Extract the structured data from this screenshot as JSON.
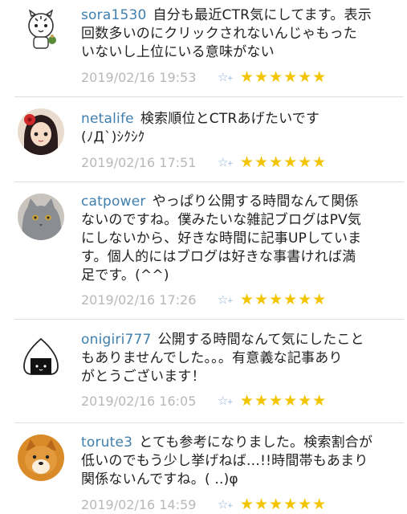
{
  "comments": [
    {
      "user": "sora1530",
      "body_lines": [
        "自分も最近CTR気にしてます。表示",
        "回数多いのにクリックされないんじゃもった",
        "いないし上位にいる意味がない"
      ],
      "timestamp": "2019/02/16 19:53",
      "add_star": "☆",
      "stars": "★★★★★★",
      "avatar": "cartoon-tiger-avatar"
    },
    {
      "user": "netalife",
      "body_lines": [
        "検索順位とCTRあげたいです",
        "(ﾉД`)ｼｸｼｸ"
      ],
      "timestamp": "2019/02/16 17:51",
      "add_star": "☆",
      "stars": "★★★★★★",
      "avatar": "anime-girl-avatar"
    },
    {
      "user": "catpower",
      "body_lines": [
        "やっぱり公開する時間なんて関係",
        "ないのですね。僕みたいな雑記ブログはPV気",
        "にしないから、好きな時間に記事UPしていま",
        "す。個人的にはブログは好きな事書ければ満",
        "足です。(^^)"
      ],
      "timestamp": "2019/02/16 17:26",
      "add_star": "☆",
      "stars": "★★★★★★",
      "avatar": "grey-cat-avatar"
    },
    {
      "user": "onigiri777",
      "body_lines": [
        "公開する時間なんて気にしたこと",
        "もありませんでした。。。有意義な記事あり",
        "がとうございます！"
      ],
      "timestamp": "2019/02/16 16:05",
      "add_star": "☆",
      "stars": "★★★★★★",
      "avatar": "onigiri-avatar"
    },
    {
      "user": "torute3",
      "body_lines": [
        "とても参考になりました。検索割合が",
        "低いのでもう少し挙げねば…!!時間帯もあまり",
        "関係ないんですね。( ..)φ"
      ],
      "timestamp": "2019/02/16 14:59",
      "add_star": "☆",
      "stars": "★★★★★★",
      "avatar": "shiba-dog-avatar"
    }
  ],
  "colors": {
    "username": "#3f7fae",
    "timestamp": "#b8b8b8",
    "star": "#f2c500",
    "add_star": "#8fb4dc"
  }
}
